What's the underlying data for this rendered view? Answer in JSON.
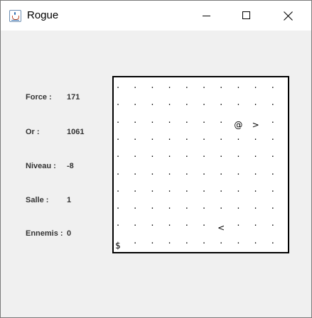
{
  "window": {
    "title": "Rogue",
    "icon": "java-cup-icon",
    "controls": [
      "minimize",
      "maximize",
      "close"
    ]
  },
  "stats": [
    {
      "label": "Force :",
      "value": "171"
    },
    {
      "label": "Or :",
      "value": "1061"
    },
    {
      "label": "Niveau :",
      "value": "-8"
    },
    {
      "label": "Salle :",
      "value": "1"
    },
    {
      "label": "Ennemis :",
      "value": "0"
    }
  ],
  "map": {
    "rows": [
      ". . . . . . . . . .",
      ". . . . . . . . . .",
      ". . . . . . . @ > .",
      ". . . . . . . . . .",
      ". . . . . . . . . .",
      ". . . . . . . . . .",
      ". . . . . . . . . .",
      ". . . . . . . . . .",
      ". . . . . . < . . .",
      "$ . . . . . . . . ."
    ],
    "legend": {
      "@": "player",
      ">": "stairs-down",
      "<": "stairs-up",
      "$": "gold",
      ".": "floor"
    }
  }
}
